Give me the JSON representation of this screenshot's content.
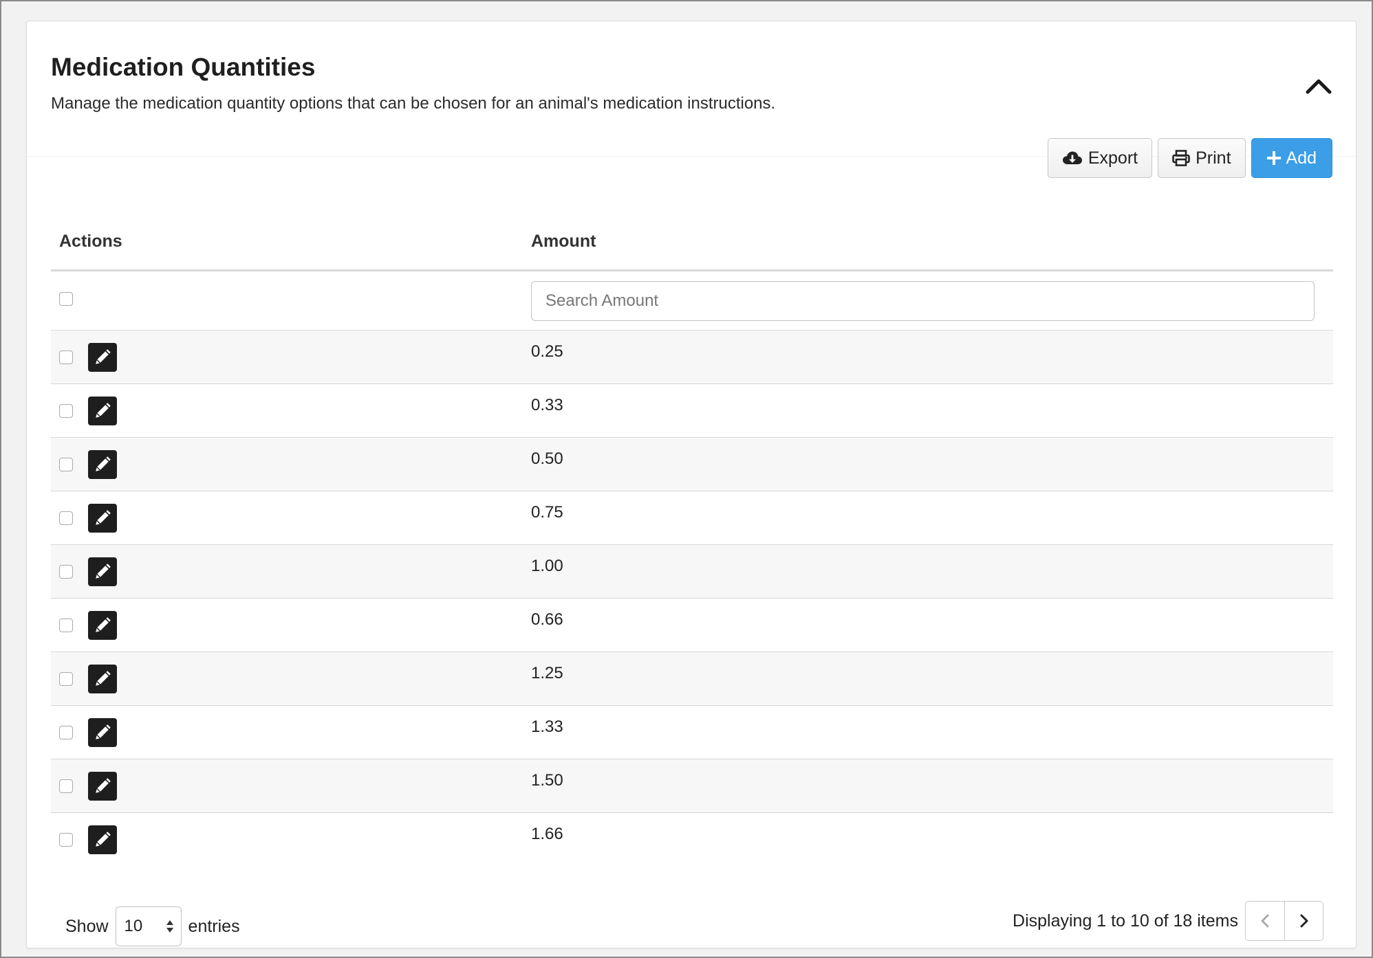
{
  "header": {
    "title": "Medication Quantities",
    "subtitle": "Manage the medication quantity options that can be chosen for an animal's medication instructions."
  },
  "toolbar": {
    "export_label": "Export",
    "print_label": "Print",
    "add_label": "Add",
    "add_color": "#3b9ee6"
  },
  "table": {
    "columns": {
      "actions": "Actions",
      "amount": "Amount"
    },
    "search_placeholder": "Search Amount",
    "rows": [
      {
        "amount": "0.25"
      },
      {
        "amount": "0.33"
      },
      {
        "amount": "0.50"
      },
      {
        "amount": "0.75"
      },
      {
        "amount": "1.00"
      },
      {
        "amount": "0.66"
      },
      {
        "amount": "1.25"
      },
      {
        "amount": "1.33"
      },
      {
        "amount": "1.50"
      },
      {
        "amount": "1.66"
      }
    ]
  },
  "footer": {
    "show_label": "Show",
    "page_size": "10",
    "entries_label": "entries",
    "display_text": "Displaying 1 to 10 of 18 items"
  },
  "icons": {
    "collapse": "chevron-up-icon",
    "export": "cloud-download-icon",
    "print": "printer-icon",
    "add": "plus-icon",
    "edit": "pencil-icon",
    "prev": "chevron-left-icon",
    "next": "chevron-right-icon"
  }
}
